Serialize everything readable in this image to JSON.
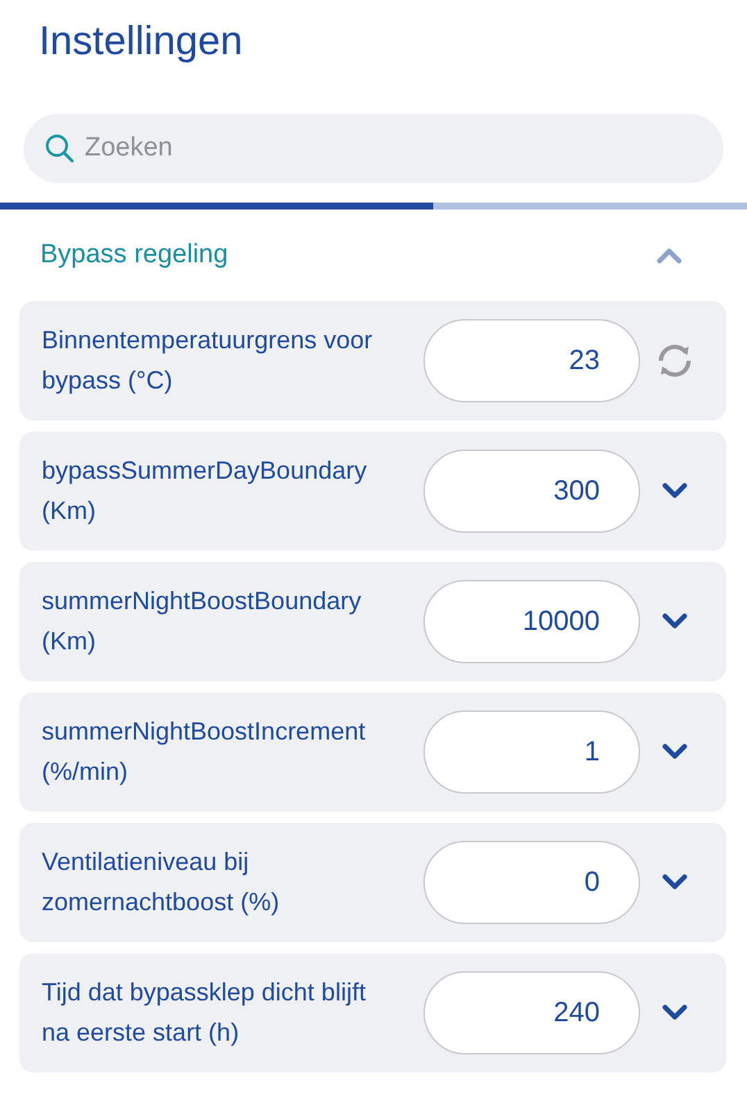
{
  "title": "Instellingen",
  "search": {
    "placeholder": "Zoeken"
  },
  "progress": {
    "level": 0.58
  },
  "section": {
    "title": "Bypass regeling",
    "expanded": true
  },
  "settings": [
    {
      "label": "Binnentemperatuurgrens voor bypass (°C)",
      "value": "23",
      "kind": "reset"
    },
    {
      "label": "bypassSummerDayBoundary (Km)",
      "value": "300",
      "kind": "dropdown"
    },
    {
      "label": "summerNightBoostBoundary (Km)",
      "value": "10000",
      "kind": "dropdown"
    },
    {
      "label": "summerNightBoostIncrement (%/min)",
      "value": "1",
      "kind": "dropdown"
    },
    {
      "label": "Ventilatieniveau bij zomernachtboost (%)",
      "value": "0",
      "kind": "dropdown"
    },
    {
      "label": "Tijd dat bypassklep dicht blijft na eerste start (h)",
      "value": "240",
      "kind": "dropdown"
    }
  ]
}
